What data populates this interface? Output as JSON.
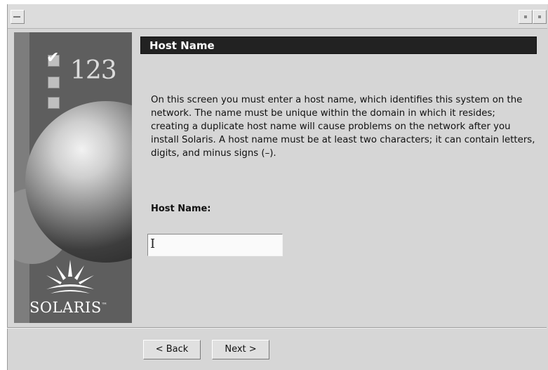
{
  "window": {
    "title": ""
  },
  "sidebar": {
    "steps_label": "123",
    "brand": "SOLARIS",
    "trademark": "™"
  },
  "page": {
    "title": "Host Name",
    "description": "On this screen you must enter a host name, which identifies this system on the network. The name must be unique within the domain in which it resides; creating a duplicate host name will cause problems on the network after you install Solaris. A host name must be at least two characters; it can contain letters, digits, and minus signs (–).",
    "field_label": "Host Name:",
    "field_value": ""
  },
  "buttons": {
    "back": "< Back",
    "next": "Next >"
  },
  "colors": {
    "header_bg": "#222222",
    "window_bg": "#d6d6d6",
    "sidebar_bg": "#5e5e5e"
  }
}
